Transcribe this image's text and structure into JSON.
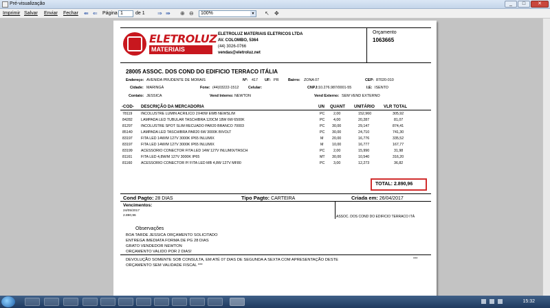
{
  "window": {
    "title": "Pré-visualização",
    "buttons": [
      "_",
      "□",
      "✕"
    ]
  },
  "toolbar": {
    "menu": [
      "Imprimir",
      "Salvar",
      "Enviar",
      "Fechar"
    ],
    "page_label": "Página",
    "page_value": "1",
    "of_label": "de 1",
    "zoom_value": "100%"
  },
  "company": {
    "logo_word1": "ELETROLUZ",
    "logo_word2": "MATERIAIS ELÉTRICOS",
    "name": "ELETROLUZ MATERIAIS ELETRICOS LTDA",
    "street": "AV. COLOMBO, 5364",
    "phone": "(44) 3026-0766",
    "email": "vendas@eletroluz.net"
  },
  "budget": {
    "label": "Orçamento",
    "number": "1063665"
  },
  "client": {
    "code_name": "28005  ASSOC. DOS COND DO EDIFICIO TERRACO ITÁLIA",
    "endereco_label": "Endereço:",
    "endereco": "AVENIDA PRUDENTE DE MORAIS",
    "numero_label": "Nº:",
    "numero": "417",
    "uf_label": "UF:",
    "uf": "PR",
    "bairro_label": "Bairro:",
    "bairro": "ZONA 07",
    "cep_label": "CEP:",
    "cep": "87020-010",
    "cidade_label": "Cidade:",
    "cidade": "MARINGÁ",
    "fone_label": "Fone:",
    "fone": "(44)03222-1512",
    "celular_label": "Celular:",
    "cnpj_label": "CNPJ:",
    "cnpj": "10.276.987/0001-55",
    "ie_label": "I.E:",
    "ie": "ISENTO",
    "contato_label": "Contato:",
    "contato": "JESSICA",
    "vend_int_label": "Vend Interno:",
    "vend_int": "NEWTON",
    "vend_ext_label": "Vend Externo:",
    "vend_ext": "SEM VEND EXTERNO"
  },
  "items": {
    "headers": [
      "-COD-",
      "DESCRIÇÃO DA MERCADORIA",
      "UN",
      "QUANT",
      "UNITÁRIO",
      "VLR TOTAL"
    ],
    "rows": [
      [
        "78119",
        "INCOLUSTRE LUMIN ACRILICO 2X40W EWB NEWSLIM",
        "PC",
        "2,00",
        "152,960",
        "305,92"
      ],
      [
        "84282",
        "LAMPADA LED TUBULAR TASCHIBRA 120CM 18W 6W 6500K",
        "PC",
        "4,00",
        "20,287",
        "81,07"
      ],
      [
        "81297",
        "INCOLUSTRE SPOT SLIM RECUADO PAR20 BRANCO 70003",
        "PC",
        "30,00",
        "29,147",
        "874,41"
      ],
      [
        "85140",
        "LAMPADA LED TASCHIBRA PAR20 6W 3000K BIVOLT",
        "PC",
        "30,00",
        "24,710",
        "741,30"
      ],
      [
        "83197",
        "FITA LED 14W/M 127V 3000K IP65 INLUMIX",
        "M",
        "20,00",
        "16,776",
        "335,52"
      ],
      [
        "83197",
        "FITA LED 14W/M 127V 3000K IP65 INLUMIX",
        "M",
        "10,00",
        "16,777",
        "167,77"
      ],
      [
        "83199",
        "ACESSORIO CONECTOR FITA LED 14W 127V INLUMIX/TASCH",
        "PC",
        "2,00",
        "15,990",
        "31,98"
      ],
      [
        "81161",
        "FITA LED 4,8W/M 127V 3000K IP65",
        "MT",
        "30,00",
        "10,540",
        "316,20"
      ],
      [
        "81160",
        "ACESSORIO CONECTOR P/ FITA LED MB 4,8W 127V   MF80",
        "PC",
        "3,00",
        "12,273",
        "36,82"
      ]
    ]
  },
  "total": {
    "label": "TOTAL:",
    "value": "2.890,96"
  },
  "payment": {
    "cond_label": "Cond Pagto:",
    "cond": "28 DIAS",
    "tipo_label": "Tipo Pagto:",
    "tipo": "CARTEIRA",
    "criada_label": "Criada em:",
    "criada": "26/04/2017"
  },
  "vencimentos": {
    "label": "Vencimentos:",
    "date": "24/05/2017",
    "value": "2.890,96",
    "right_text": "ASSOC. DOS COND DO EDIFICIO TERRACO ITÁ"
  },
  "observacoes": {
    "label": "Observações",
    "lines": [
      "BOA TARDE JESSICA ORÇAMENTO SOLICITADO",
      "ENTREGA IMEDIATA FORMA DE PG 28 DIAS",
      "GRATO VENDEDOR NEWTON",
      "ORÇAMENTO VALIDO POR 2 DIAS!"
    ]
  },
  "footer": {
    "line1": "DEVOLUÇÃO SOMENTE SOB CONSULTA, EM ATÉ 07 DIAS DE SEGUNDA A SEXTA COM APRESENTAÇÃO DESTE",
    "line2": "ORÇAMENTO SEM VALIDADE FISCAL   ***",
    "stars": "***"
  },
  "taskbar": {
    "clock": "15:32"
  }
}
